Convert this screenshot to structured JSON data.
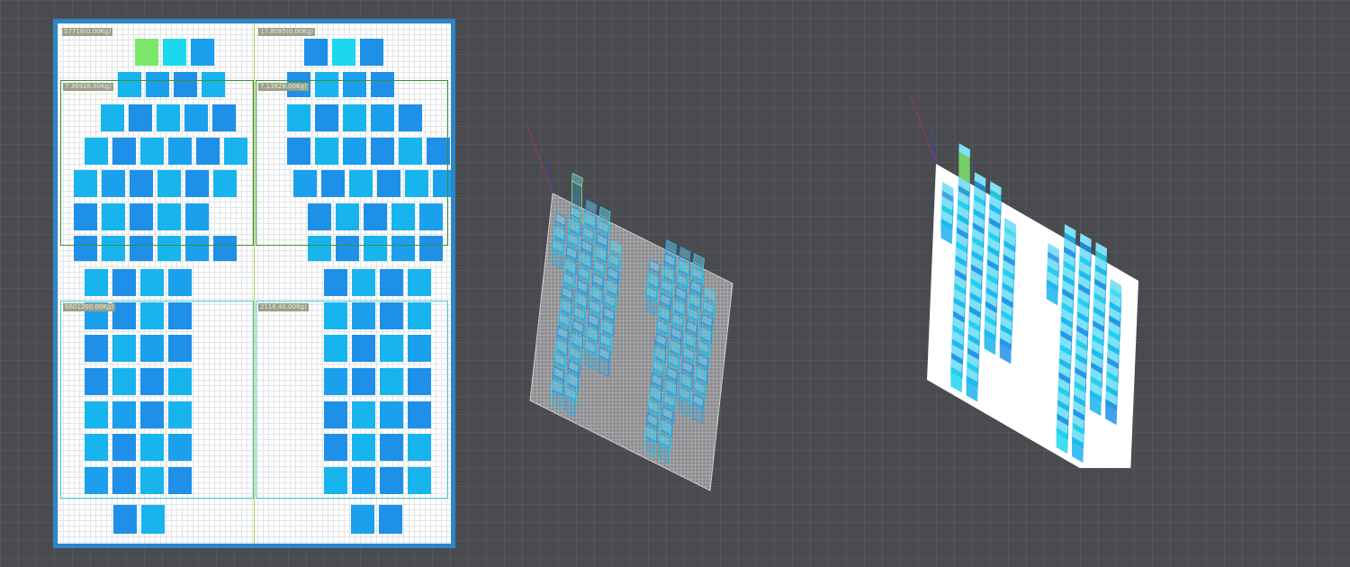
{
  "view_2d": {
    "zones": [
      {
        "id": "toe-left",
        "label": "57718(0.00Kg)",
        "color": "#9aa08a"
      },
      {
        "id": "toe-right",
        "label": "17.8095(0.00Kg)",
        "color": "#9aa08a"
      },
      {
        "id": "fore-left",
        "label": "7.36928.00Kg)",
        "color": "#3e8f3a"
      },
      {
        "id": "fore-right",
        "label": "7.13828.00Kg)",
        "color": "#3e8f3a"
      },
      {
        "id": "heel-left",
        "label": "6601200.00Kg)",
        "color": "#4fc8d8"
      },
      {
        "id": "heel-right",
        "label": "2116.40.00Kg)",
        "color": "#4fc8d8"
      }
    ]
  },
  "views_3d": [
    {
      "id": "wireframe",
      "render_mode": "wireframe"
    },
    {
      "id": "solid",
      "render_mode": "solid"
    }
  ],
  "colors": {
    "background": "#4a4b4f",
    "frame": "#2b86c5",
    "cell_low": "#1e90e8",
    "cell_mid": "#17b4ee",
    "cell_high": "#1cd8ef",
    "cell_peak": "#7ce86a",
    "axis_x": "#8a3a6a",
    "axis_y": "#3a4aa8"
  }
}
